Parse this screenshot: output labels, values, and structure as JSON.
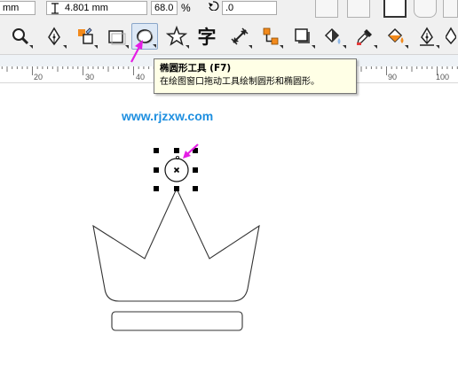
{
  "property_bar": {
    "unit_left": "mm",
    "height_value": "4.801 mm",
    "scale_value": "68.0",
    "percent_label": "%",
    "rotation_value": ".0"
  },
  "toolbox": {
    "tools": [
      {
        "name": "zoom-tool",
        "icon": "magnifier-icon"
      },
      {
        "name": "freehand-tool",
        "icon": "pen-nib-icon"
      },
      {
        "name": "smart-fill-tool",
        "icon": "smart-fill-icon"
      },
      {
        "name": "rectangle-tool",
        "icon": "rectangle-icon"
      },
      {
        "name": "ellipse-tool",
        "icon": "ellipse-icon",
        "active": true
      },
      {
        "name": "polygon-tool",
        "icon": "star-icon"
      },
      {
        "name": "text-tool",
        "icon": "text-glyph-icon",
        "glyph": "字"
      },
      {
        "name": "dimension-tool",
        "icon": "dimension-icon"
      },
      {
        "name": "connector-tool",
        "icon": "connector-icon"
      },
      {
        "name": "drop-shadow-tool",
        "icon": "shadow-icon"
      },
      {
        "name": "transparency-tool",
        "icon": "transparency-icon"
      },
      {
        "name": "eyedropper-tool",
        "icon": "eyedropper-icon"
      },
      {
        "name": "fill-tool",
        "icon": "paint-bucket-icon"
      },
      {
        "name": "outline-tool",
        "icon": "outline-pen-icon"
      }
    ]
  },
  "ruler": {
    "labels": [
      "20",
      "30",
      "40",
      "90",
      "100"
    ]
  },
  "tooltip": {
    "title": "椭圆形工具 (F7)",
    "description": "在绘图窗口拖动工具绘制圆形和椭圆形。"
  },
  "watermark": "www.rjzxw.com",
  "colors": {
    "accent_arrow": "#e51ee5",
    "watermark": "#1e8fe0",
    "tooltip_bg": "#ffffe6"
  }
}
